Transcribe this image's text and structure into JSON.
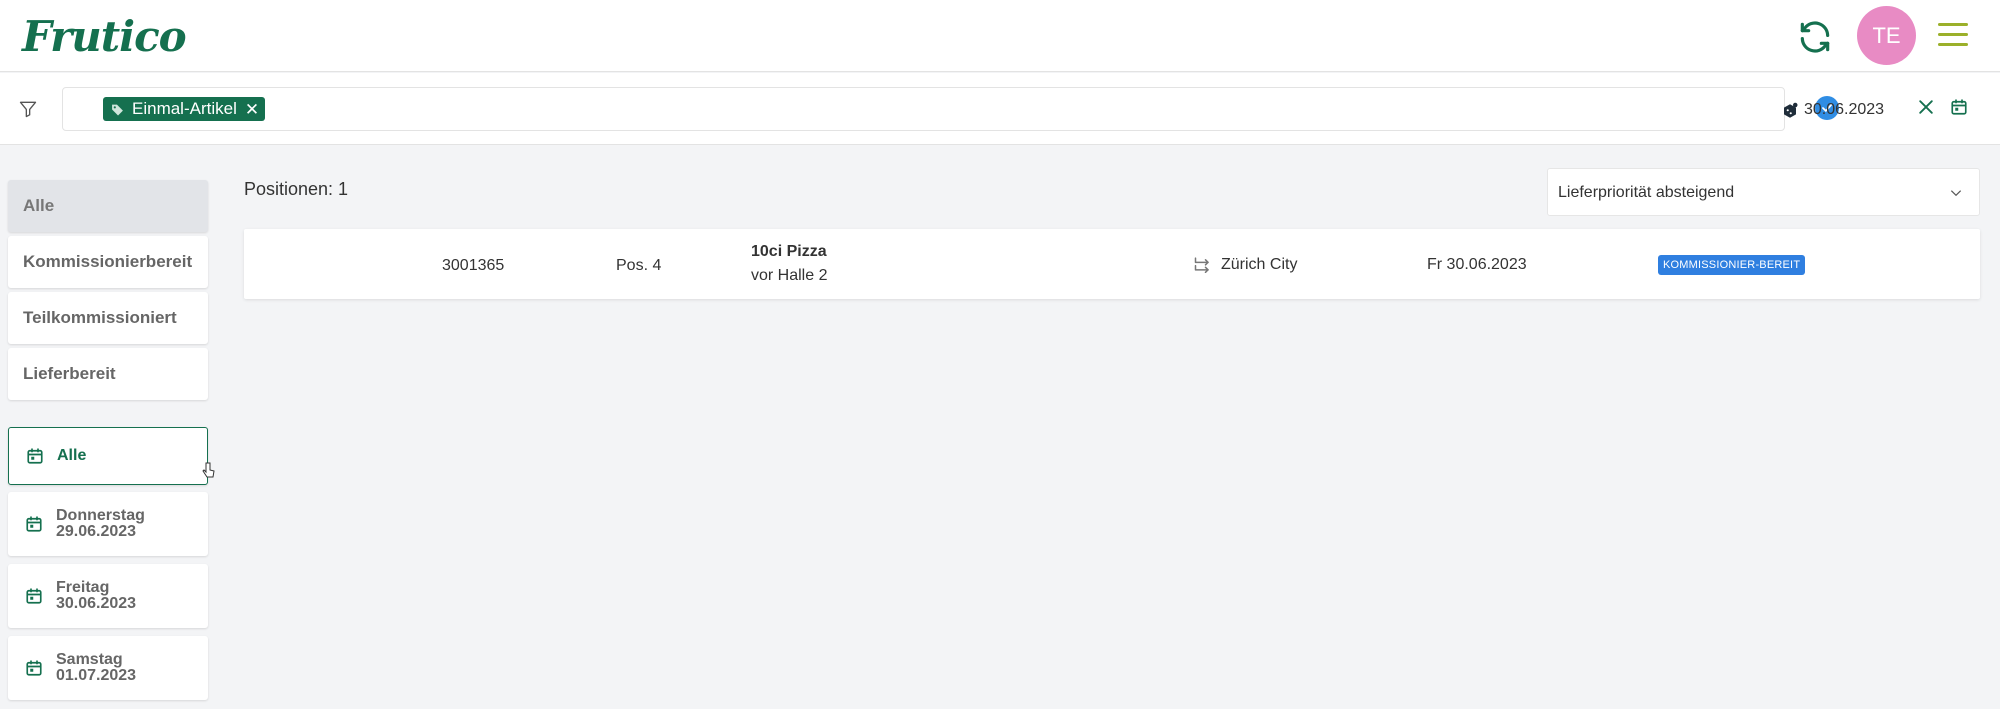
{
  "app": {
    "logo_text": "Frutico",
    "avatar_initials": "TE"
  },
  "filter": {
    "chip_label": "Einmal-Artikel",
    "date": "30.06.2023"
  },
  "sidebar": {
    "status_items": [
      {
        "label": "Alle",
        "active": true
      },
      {
        "label": "Kommissionierbereit",
        "active": false
      },
      {
        "label": "Teilkommissioniert",
        "active": false
      },
      {
        "label": "Lieferbereit",
        "active": false
      }
    ],
    "date_items": [
      {
        "line1": "Alle",
        "line2": "",
        "selected": true
      },
      {
        "line1": "Donnerstag",
        "line2": "29.06.2023",
        "selected": false
      },
      {
        "line1": "Freitag",
        "line2": "30.06.2023",
        "selected": false
      },
      {
        "line1": "Samstag",
        "line2": "01.07.2023",
        "selected": false
      }
    ]
  },
  "main": {
    "positions_label": "Positionen: 1",
    "sort_value": "Lieferpriorität absteigend",
    "rows": [
      {
        "id": "3001365",
        "pos": "Pos. 4",
        "name": "10ci Pizza",
        "location": "vor Halle 2",
        "route": "Zürich City",
        "date": "Fr 30.06.2023",
        "status": "KOMMISSIONIER-BEREIT"
      }
    ]
  },
  "colors": {
    "brand_green": "#15704f",
    "avatar_pink": "#e88bc4",
    "menu_olive": "#9bb02a",
    "badge_blue": "#2f7fe0",
    "check_blue": "#2f8de4"
  },
  "icons": {
    "refresh": "refresh-icon",
    "menu": "hamburger-menu-icon",
    "filter": "filter-funnel-icon",
    "tag": "tag-icon",
    "close": "close-icon",
    "dice": "dice-icon",
    "check": "check-circle-icon",
    "calendar": "calendar-icon",
    "route": "route-icon",
    "chevron": "chevron-down-icon"
  }
}
